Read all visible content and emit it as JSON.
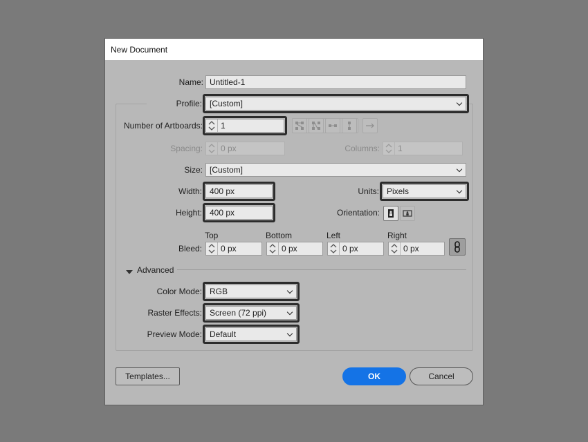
{
  "dialog": {
    "title": "New Document",
    "name": {
      "label": "Name:",
      "value": "Untitled-1"
    },
    "profile": {
      "label": "Profile:",
      "value": "[Custom]"
    },
    "artboards": {
      "label": "Number of Artboards:",
      "value": "1"
    },
    "spacing": {
      "label": "Spacing:",
      "value": "0 px"
    },
    "columns": {
      "label": "Columns:",
      "value": "1"
    },
    "size": {
      "label": "Size:",
      "value": "[Custom]"
    },
    "width": {
      "label": "Width:",
      "value": "400 px"
    },
    "height": {
      "label": "Height:",
      "value": "400 px"
    },
    "units": {
      "label": "Units:",
      "value": "Pixels"
    },
    "orientation": {
      "label": "Orientation:"
    },
    "bleed": {
      "label": "Bleed:",
      "top": {
        "label": "Top",
        "value": "0 px"
      },
      "bottom": {
        "label": "Bottom",
        "value": "0 px"
      },
      "left": {
        "label": "Left",
        "value": "0 px"
      },
      "right": {
        "label": "Right",
        "value": "0 px"
      }
    },
    "advanced": {
      "label": "Advanced"
    },
    "color_mode": {
      "label": "Color Mode:",
      "value": "RGB"
    },
    "raster_effects": {
      "label": "Raster Effects:",
      "value": "Screen (72 ppi)"
    },
    "preview_mode": {
      "label": "Preview Mode:",
      "value": "Default"
    },
    "buttons": {
      "templates": "Templates...",
      "ok": "OK",
      "cancel": "Cancel"
    }
  },
  "colors": {
    "accent": "#1473e6",
    "background": "#7a7a7a",
    "dialog": "#b8b8b8"
  },
  "icons": [
    "arrange-grid-by-row-icon",
    "arrange-grid-by-column-icon",
    "arrange-by-row-icon",
    "arrange-by-column-icon",
    "right-to-left-layout-icon",
    "portrait-icon",
    "landscape-icon",
    "link-icon",
    "triangle-down-icon"
  ]
}
